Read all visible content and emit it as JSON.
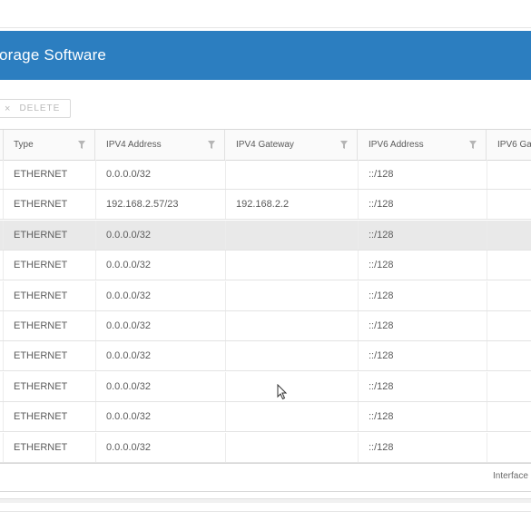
{
  "header": {
    "title": "orage Software"
  },
  "toolbar": {
    "delete_icon": "×",
    "delete_label": "DELETE"
  },
  "table": {
    "columns": [
      {
        "label": "Type"
      },
      {
        "label": "IPV4 Address"
      },
      {
        "label": "IPV4 Gateway"
      },
      {
        "label": "IPV6 Address"
      },
      {
        "label": "IPV6 Ga"
      }
    ],
    "rows": [
      {
        "type": "ETHERNET",
        "ipv4": "0.0.0.0/32",
        "gateway": "",
        "ipv6": "::/128"
      },
      {
        "type": "ETHERNET",
        "ipv4": "192.168.2.57/23",
        "gateway": "192.168.2.2",
        "ipv6": "::/128"
      },
      {
        "type": "ETHERNET",
        "ipv4": "0.0.0.0/32",
        "gateway": "",
        "ipv6": "::/128"
      },
      {
        "type": "ETHERNET",
        "ipv4": "0.0.0.0/32",
        "gateway": "",
        "ipv6": "::/128"
      },
      {
        "type": "ETHERNET",
        "ipv4": "0.0.0.0/32",
        "gateway": "",
        "ipv6": "::/128"
      },
      {
        "type": "ETHERNET",
        "ipv4": "0.0.0.0/32",
        "gateway": "",
        "ipv6": "::/128"
      },
      {
        "type": "ETHERNET",
        "ipv4": "0.0.0.0/32",
        "gateway": "",
        "ipv6": "::/128"
      },
      {
        "type": "ETHERNET",
        "ipv4": "0.0.0.0/32",
        "gateway": "",
        "ipv6": "::/128"
      },
      {
        "type": "ETHERNET",
        "ipv4": "0.0.0.0/32",
        "gateway": "",
        "ipv6": "::/128"
      },
      {
        "type": "ETHERNET",
        "ipv4": "0.0.0.0/32",
        "gateway": "",
        "ipv6": "::/128"
      }
    ]
  },
  "footer": {
    "text": "Interface"
  },
  "colors": {
    "header_bg": "#2c7ec0",
    "selected_row_bg": "#e9e9e9"
  },
  "icons": {
    "filter": "funnel-icon",
    "cursor": "mouse-pointer-icon"
  }
}
